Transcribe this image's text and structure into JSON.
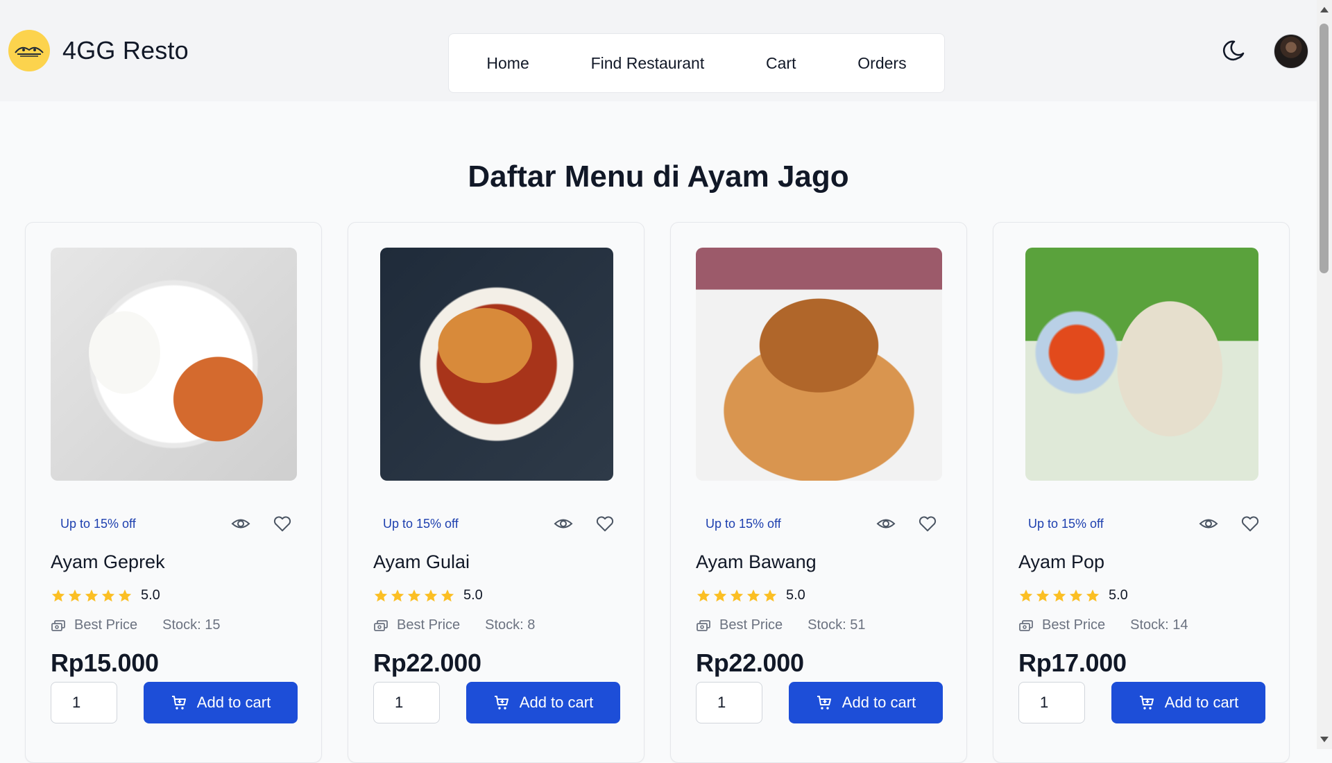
{
  "header": {
    "brand_name": "4GG Resto",
    "nav": [
      {
        "label": "Home"
      },
      {
        "label": "Find Restaurant"
      },
      {
        "label": "Cart"
      },
      {
        "label": "Orders"
      }
    ],
    "theme_icon": "moon-icon",
    "avatar_icon": "user-avatar"
  },
  "page": {
    "title": "Daftar Menu di Ayam Jago"
  },
  "menu": [
    {
      "badge": "Up to 15% off",
      "name": "Ayam Geprek",
      "rating": "5.0",
      "stars": 5,
      "info_label": "Best Price",
      "stock": "Stock: 15",
      "price": "Rp15.000",
      "quantity": "1",
      "button_label": "Add to cart"
    },
    {
      "badge": "Up to 15% off",
      "name": "Ayam Gulai",
      "rating": "5.0",
      "stars": 5,
      "info_label": "Best Price",
      "stock": "Stock: 8",
      "price": "Rp22.000",
      "quantity": "1",
      "button_label": "Add to cart"
    },
    {
      "badge": "Up to 15% off",
      "name": "Ayam Bawang",
      "rating": "5.0",
      "stars": 5,
      "info_label": "Best Price",
      "stock": "Stock: 51",
      "price": "Rp22.000",
      "quantity": "1",
      "button_label": "Add to cart"
    },
    {
      "badge": "Up to 15% off",
      "name": "Ayam Pop",
      "rating": "5.0",
      "stars": 5,
      "info_label": "Best Price",
      "stock": "Stock: 14",
      "price": "Rp17.000",
      "quantity": "1",
      "button_label": "Add to cart"
    }
  ],
  "colors": {
    "primary_button": "#1D4ED8",
    "badge_text": "#1E40AF",
    "star": "#FBBF24",
    "header_bg": "#F3F4F6",
    "logo_bg": "#FCD34D"
  }
}
